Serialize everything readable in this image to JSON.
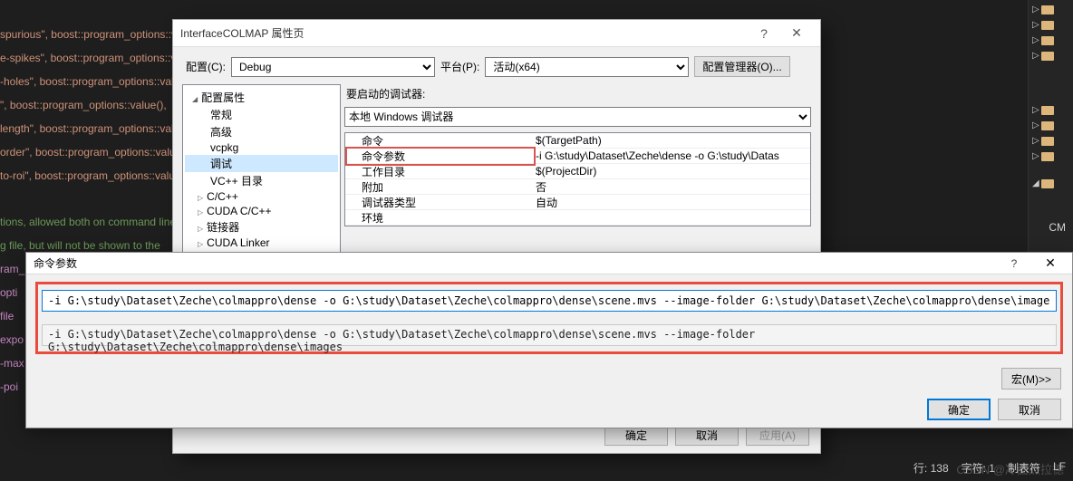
{
  "code_bg": {
    "lines": [
      "spurious\", boost::program_options::value(&OPT::bRemoveSpurious)->default_value(20.f),  \"spurious facto",
      "e-spikes\", boost::program_options::value(&OPT::bRemoveSpikes)->default_value(true),  \"flag controlling t",
      "-holes\", boost::program_options::value(&OPT::nCloseHoles),                          close small holes",
      "\", boost::program_options::value(),                                                 rations to smooth",
      "length\", boost::program_options::value(),                                           such that the av",
      "order\", boost::program_options::value(),                                            r to the region-",
      "to-roi\", boost::program_options::value(),                                           ene using the reg"
    ],
    "green_lines": [
      "tions, allowed both on command line",
      "g file, but will not be shown to the"
    ],
    "ids": [
      "ram_",
      "opti",
      "file",
      "expo",
      "-max",
      "-poi"
    ]
  },
  "dialog1": {
    "title": "InterfaceCOLMAP 属性页",
    "config_label": "配置(C):",
    "config_value": "Debug",
    "platform_label": "平台(P):",
    "platform_value": "活动(x64)",
    "config_mgr": "配置管理器(O)...",
    "tree": {
      "root": "配置属性",
      "items": [
        "常规",
        "高级",
        "vcpkg",
        "调试",
        "VC++ 目录"
      ],
      "collapsed": [
        "C/C++",
        "CUDA C/C++",
        "链接器",
        "CUDA Linker"
      ]
    },
    "right": {
      "section": "要启动的调试器:",
      "debugger": "本地 Windows 调试器",
      "props": [
        {
          "k": "命令",
          "v": "$(TargetPath)"
        },
        {
          "k": "命令参数",
          "v": "-i G:\\study\\Dataset\\Zeche\\dense -o G:\\study\\Datas"
        },
        {
          "k": "工作目录",
          "v": "$(ProjectDir)"
        },
        {
          "k": "附加",
          "v": "否"
        },
        {
          "k": "调试器类型",
          "v": "自动"
        },
        {
          "k": "环境",
          "v": ""
        }
      ]
    },
    "buttons": {
      "ok": "确定",
      "cancel": "取消",
      "apply": "应用(A)"
    }
  },
  "dialog2": {
    "title": "命令参数",
    "input_value": "-i G:\\study\\Dataset\\Zeche\\colmappro\\dense -o G:\\study\\Dataset\\Zeche\\colmappro\\dense\\scene.mvs --image-folder G:\\study\\Dataset\\Zeche\\colmappro\\dense\\images",
    "echo_value": "-i G:\\study\\Dataset\\Zeche\\colmappro\\dense -o G:\\study\\Dataset\\Zeche\\colmappro\\dense\\scene.mvs --image-folder G:\\study\\Dataset\\Zeche\\colmappro\\dense\\images",
    "macro_btn": "宏(M)>>",
    "ok": "确定",
    "cancel": "取消"
  },
  "status": {
    "line": "行: 138",
    "char": "字符: 1",
    "tabs": "制表符",
    "lf": "LF"
  },
  "watermark": "CSDN @冷面杰拉德",
  "folder_label": "CM"
}
